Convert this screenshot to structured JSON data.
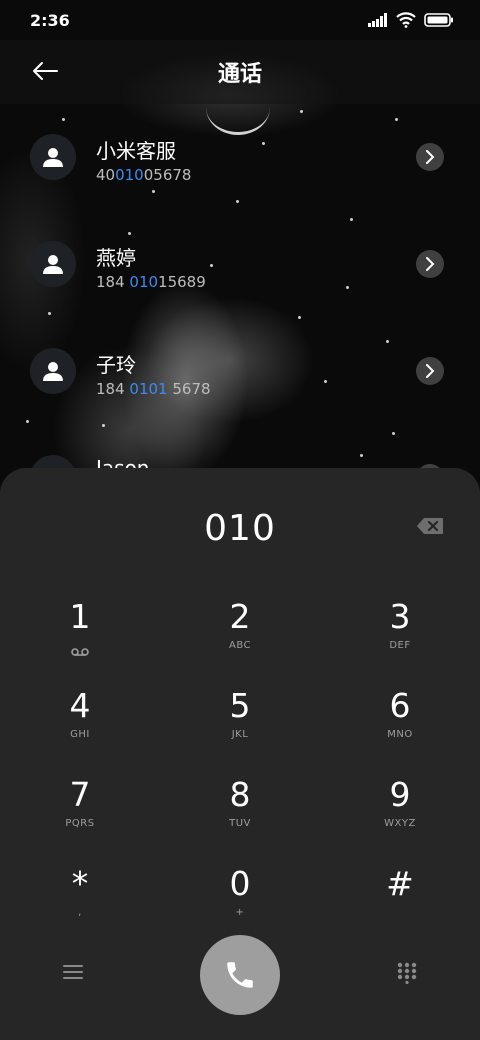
{
  "status": {
    "time": "2:36"
  },
  "header": {
    "title": "通话",
    "back_icon": "back-arrow-icon"
  },
  "contacts": [
    {
      "name": "小米客服",
      "num_pre": "40",
      "num_match": "010",
      "num_post": "05678"
    },
    {
      "name": "燕婷",
      "num_pre": "184 ",
      "num_match": "010",
      "num_post": "15689"
    },
    {
      "name": "子玲",
      "num_pre": "184 ",
      "num_match": "0101",
      "num_post": " 5678"
    },
    {
      "name": "Jason",
      "num_pre": "",
      "num_match": "",
      "num_post": ""
    }
  ],
  "dialer": {
    "input": "010",
    "keys": [
      {
        "digit": "1",
        "sub": "",
        "sub_icon": "voicemail-icon"
      },
      {
        "digit": "2",
        "sub": "ABC"
      },
      {
        "digit": "3",
        "sub": "DEF"
      },
      {
        "digit": "4",
        "sub": "GHI"
      },
      {
        "digit": "5",
        "sub": "JKL"
      },
      {
        "digit": "6",
        "sub": "MNO"
      },
      {
        "digit": "7",
        "sub": "PQRS"
      },
      {
        "digit": "8",
        "sub": "TUV"
      },
      {
        "digit": "9",
        "sub": "WXYZ"
      },
      {
        "digit": "*",
        "sub": ","
      },
      {
        "digit": "0",
        "sub": "+"
      },
      {
        "digit": "#",
        "sub": ""
      }
    ]
  },
  "colors": {
    "match_highlight": "#3d8bf2",
    "dialpad_bg": "#262626",
    "call_button": "#9e9e9e"
  }
}
